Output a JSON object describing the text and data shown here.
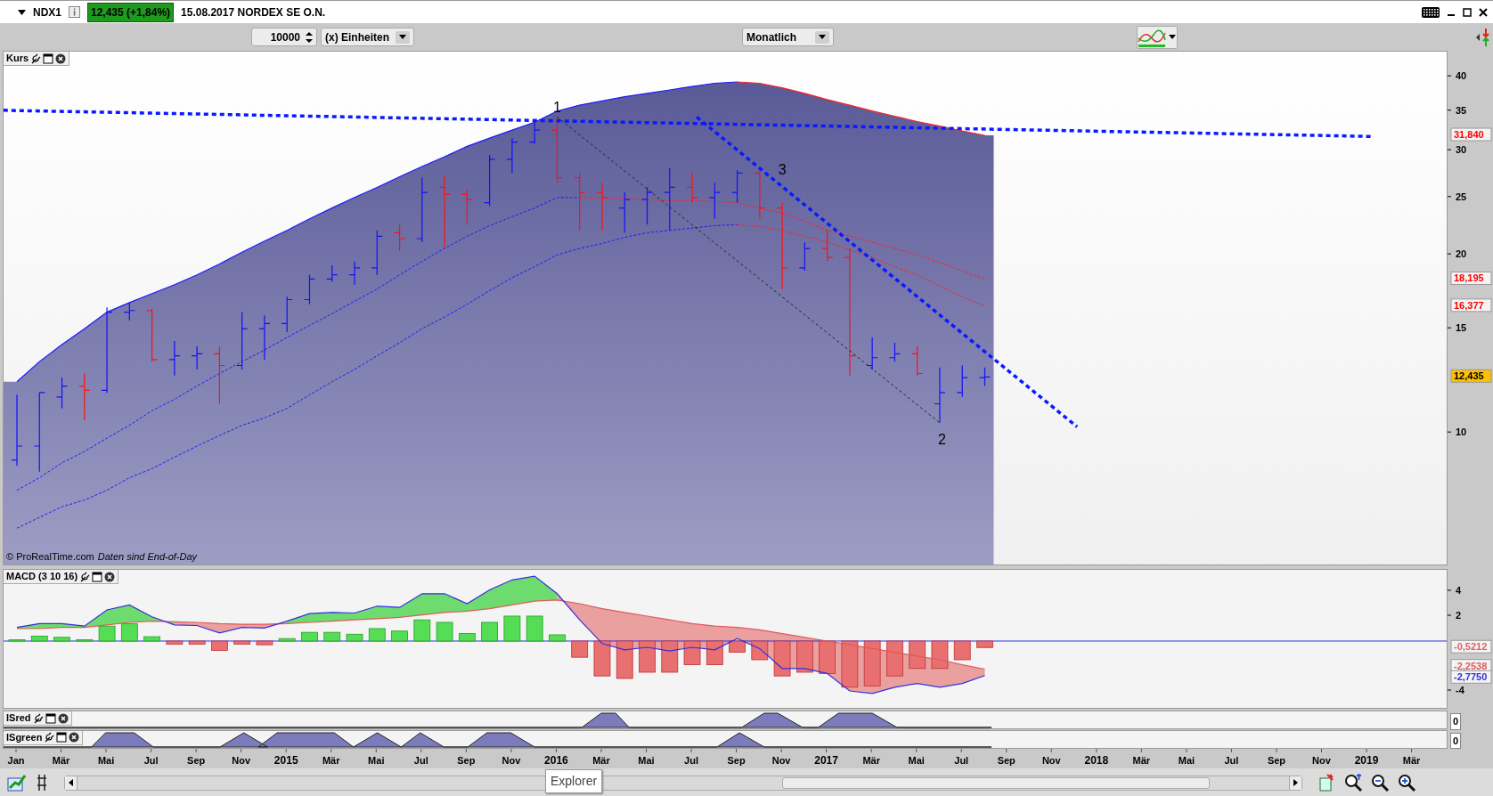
{
  "top_bar": {
    "symbol": "NDX1",
    "quote": "12,435 (+1,84%)",
    "title": "15.08.2017 NORDEX SE O.N."
  },
  "toolbar": {
    "quantity": "10000",
    "unit": "(x) Einheiten",
    "period": "Monatlich"
  },
  "price_panel": {
    "title": "Kurs",
    "copyright": "© ProRealTime.com",
    "note": "Daten sind End-of-Day",
    "axis_ticks": [
      "40",
      "35",
      "30",
      "25",
      "20",
      "15",
      "10"
    ],
    "value_tags": [
      {
        "text": "31,840",
        "kind": "band"
      },
      {
        "text": "18,195",
        "kind": "band"
      },
      {
        "text": "16,377",
        "kind": "band"
      },
      {
        "text": "12,435",
        "kind": "last"
      }
    ],
    "point_labels": [
      "1",
      "3",
      "2"
    ]
  },
  "macd_panel": {
    "title": "MACD (3 10 16)",
    "axis_ticks": [
      "4",
      "2",
      "-4"
    ],
    "value_tags": [
      {
        "text": "-0,5212",
        "color": "#e06060"
      },
      {
        "text": "-2,2538",
        "color": "#e05a5a"
      },
      {
        "text": "-2,7750",
        "color": "#3030e0"
      }
    ]
  },
  "indicator_panels": [
    {
      "title": "ISred",
      "axis_label": "0"
    },
    {
      "title": "ISgreen",
      "axis_label": "0"
    }
  ],
  "time_axis": [
    {
      "label": "Jan",
      "kind": "month"
    },
    {
      "label": "Mär",
      "kind": "month"
    },
    {
      "label": "Mai",
      "kind": "month"
    },
    {
      "label": "Jul",
      "kind": "month"
    },
    {
      "label": "Sep",
      "kind": "month"
    },
    {
      "label": "Nov",
      "kind": "month"
    },
    {
      "label": "2015",
      "kind": "year"
    },
    {
      "label": "Mär",
      "kind": "month"
    },
    {
      "label": "Mai",
      "kind": "month"
    },
    {
      "label": "Jul",
      "kind": "month"
    },
    {
      "label": "Sep",
      "kind": "month"
    },
    {
      "label": "Nov",
      "kind": "month"
    },
    {
      "label": "2016",
      "kind": "year"
    },
    {
      "label": "Mär",
      "kind": "month"
    },
    {
      "label": "Mai",
      "kind": "month"
    },
    {
      "label": "Jul",
      "kind": "month"
    },
    {
      "label": "Sep",
      "kind": "month"
    },
    {
      "label": "Nov",
      "kind": "month"
    },
    {
      "label": "2017",
      "kind": "year"
    },
    {
      "label": "Mär",
      "kind": "month"
    },
    {
      "label": "Mai",
      "kind": "month"
    },
    {
      "label": "Jul",
      "kind": "month"
    },
    {
      "label": "Sep",
      "kind": "month"
    },
    {
      "label": "Nov",
      "kind": "month"
    },
    {
      "label": "2018",
      "kind": "year"
    },
    {
      "label": "Mär",
      "kind": "month"
    },
    {
      "label": "Mai",
      "kind": "month"
    },
    {
      "label": "Jul",
      "kind": "month"
    },
    {
      "label": "Sep",
      "kind": "month"
    },
    {
      "label": "Nov",
      "kind": "month"
    },
    {
      "label": "2019",
      "kind": "year"
    },
    {
      "label": "Mär",
      "kind": "month"
    }
  ],
  "tooltip": "Explorer"
}
